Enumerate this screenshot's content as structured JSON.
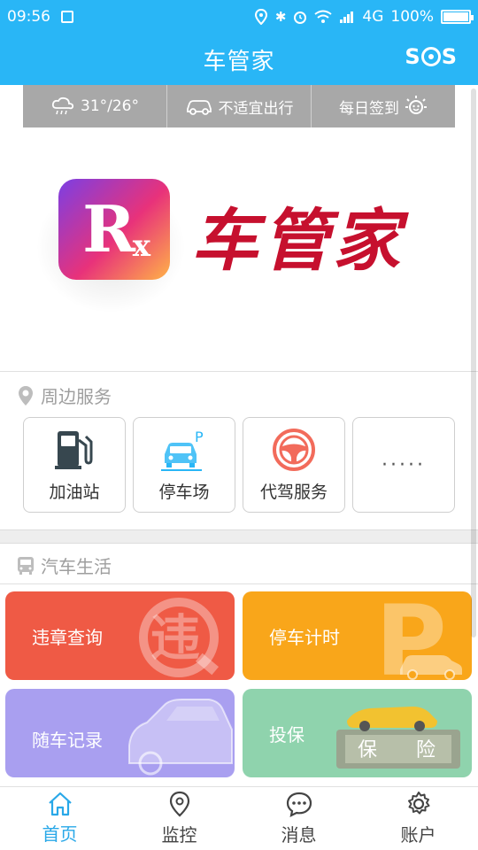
{
  "status_bar": {
    "time": "09:56",
    "network": "4G",
    "battery": "100%",
    "battery_level": 1.0
  },
  "header": {
    "title": "车管家",
    "sos_label": "SOS"
  },
  "info_bar": {
    "weather": "31°/26°",
    "travel": "不适宜出行",
    "checkin": "每日签到"
  },
  "brand": {
    "logo_letter": "R",
    "logo_sub": "x",
    "name": "车管家",
    "brand_color": "#c6102e"
  },
  "nearby": {
    "title": "周边服务",
    "items": [
      {
        "label": "加油站",
        "icon": "gas-station-icon"
      },
      {
        "label": "停车场",
        "icon": "parking-car-icon"
      },
      {
        "label": "代驾服务",
        "icon": "steering-wheel-icon"
      },
      {
        "label": "·····",
        "icon": "more-icon"
      }
    ]
  },
  "car_life": {
    "title": "汽车生活",
    "tiles": [
      {
        "label": "违章查询",
        "color": "#ef5a45",
        "icon": "violation-icon"
      },
      {
        "label": "停车计时",
        "color": "#f9a61a",
        "icon": "parking-timer-icon"
      },
      {
        "label": "随车记录",
        "color": "#a99ff0",
        "icon": "car-record-icon"
      },
      {
        "label": "投保",
        "color": "#8fd3ad",
        "icon": "insurance-icon"
      }
    ]
  },
  "nav": {
    "items": [
      {
        "label": "首页",
        "icon": "home-icon",
        "active": true
      },
      {
        "label": "监控",
        "icon": "location-pin-icon",
        "active": false
      },
      {
        "label": "消息",
        "icon": "message-icon",
        "active": false
      },
      {
        "label": "账户",
        "icon": "gear-icon",
        "active": false
      }
    ],
    "active_color": "#29a8e8"
  },
  "colors": {
    "primary": "#29b6f6"
  }
}
